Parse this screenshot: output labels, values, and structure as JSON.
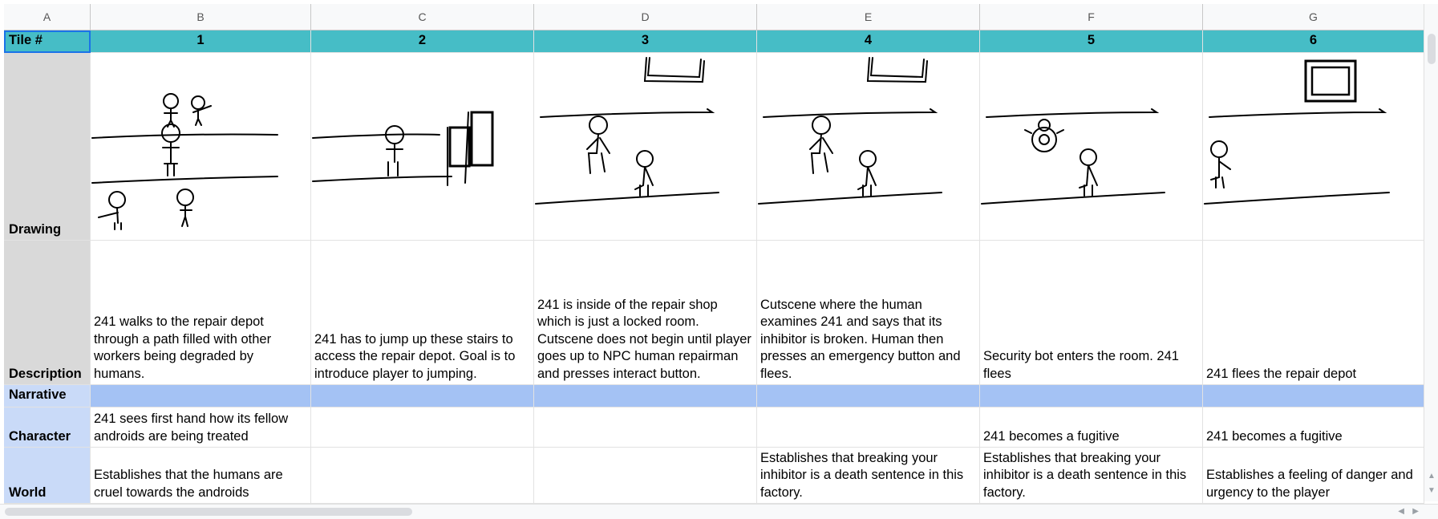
{
  "columns": [
    "A",
    "B",
    "C",
    "D",
    "E",
    "F",
    "G"
  ],
  "header_row": {
    "label": "Tile #",
    "tiles": [
      "1",
      "2",
      "3",
      "4",
      "5",
      "6"
    ]
  },
  "drawing_row": {
    "label": "Drawing"
  },
  "description_row": {
    "label": "Description",
    "values": [
      "241 walks to the repair depot through a path filled with other workers being degraded by humans.",
      "241 has to jump up these stairs to access the repair depot. Goal is to introduce player to jumping.",
      "241 is inside of the repair shop which is just a locked room. Cutscene does not begin until player goes up to NPC human repairman and presses interact button.",
      "Cutscene where the human examines 241 and says that its inhibitor is broken. Human then presses an emergency button and flees.",
      "Security bot enters the room. 241 flees",
      "241 flees the repair depot"
    ]
  },
  "narrative_row": {
    "label": "Narrative"
  },
  "character_row": {
    "label": "Character",
    "values": [
      "241 sees first hand how its fellow androids are being treated",
      "",
      "",
      "",
      "241 becomes a fugitive",
      "241 becomes a fugitive"
    ]
  },
  "world_row": {
    "label": "World",
    "values": [
      "Establishes that the humans are cruel towards the androids",
      "",
      "",
      "Establishes that breaking your inhibitor is a death sentence in this factory.",
      "Establishes that breaking your inhibitor is a death sentence in this factory.",
      "Establishes a feeling of danger and urgency to the player"
    ]
  },
  "colors": {
    "tile_header": "#46bdc6",
    "narrative": "#a4c2f4",
    "label_gray": "#d9d9d9",
    "label_blue": "#c9daf8",
    "selection": "#1a73e8"
  }
}
